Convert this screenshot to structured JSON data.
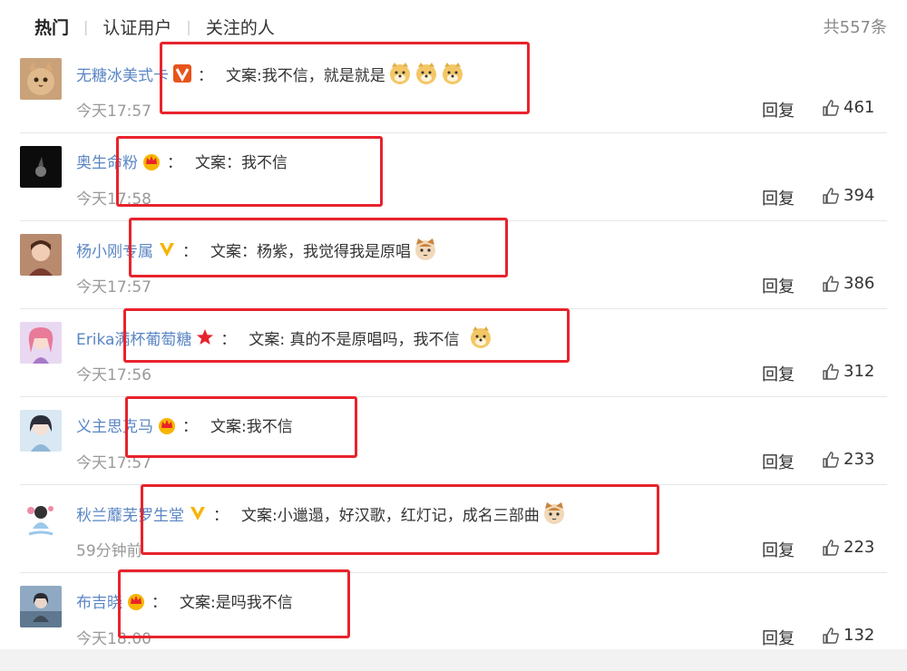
{
  "tabs": [
    "热门",
    "认证用户",
    "关注的人"
  ],
  "total": "共557条",
  "reply_label": "回复",
  "comments": [
    {
      "user": "无糖冰美式卡",
      "badge": "vip-v-orange",
      "colon": "：",
      "text": "文案:我不信，就是就是",
      "emoji": [
        "doge-emoji",
        "doge-emoji",
        "doge-emoji"
      ],
      "time": "今天17:57",
      "likes": "461"
    },
    {
      "user": "奥生命粉",
      "badge": "crown",
      "colon": "：",
      "text": "文案：我不信",
      "emoji": [],
      "time": "今天17:58",
      "likes": "394"
    },
    {
      "user": "杨小刚专属",
      "badge": "v-yellow",
      "colon": "：",
      "text": "文案：杨紫，我觉得我是原唱",
      "emoji": [
        "cat-emoji"
      ],
      "time": "今天17:57",
      "likes": "386"
    },
    {
      "user": "Erika满杯葡萄糖",
      "badge": "star",
      "colon": "：",
      "text": "文案: 真的不是原唱吗，我不信",
      "emoji": [
        "doge-emoji"
      ],
      "time": "今天17:56",
      "likes": "312"
    },
    {
      "user": "义主思克马",
      "badge": "crown",
      "colon": "：",
      "text": "文案:我不信",
      "emoji": [],
      "time": "今天17:57",
      "likes": "233"
    },
    {
      "user": "秋兰蘼芜罗生堂",
      "badge": "v-yellow",
      "colon": "：",
      "text": "文案:小邋遢，好汉歌，红灯记，成名三部曲",
      "emoji": [
        "cat-emoji"
      ],
      "time": "59分钟前",
      "likes": "223"
    },
    {
      "user": "布吉晓",
      "badge": "crown",
      "colon": "：",
      "text": "文案:是吗我不信",
      "emoji": [],
      "time": "今天18:00",
      "likes": "132"
    }
  ],
  "colors": {
    "username": "#5a86c4",
    "highlight": "#e8232c",
    "muted": "#999999"
  }
}
